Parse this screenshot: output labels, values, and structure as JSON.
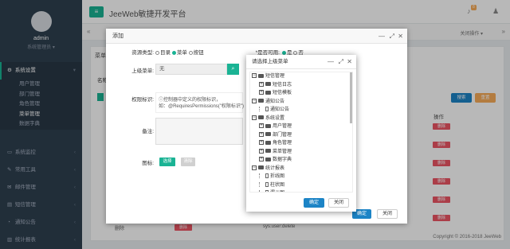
{
  "topbar": {
    "title": "JeeWeb敏捷开发平台",
    "close_ops": "关闭操作 ▾"
  },
  "sidebar": {
    "user": {
      "name": "admin",
      "role": "系统管理员 ▾"
    },
    "sections": [
      {
        "label": "系统设置",
        "icon": "gear-icon"
      },
      {
        "label": "系统监控",
        "icon": "monitor-icon"
      },
      {
        "label": "常用工具",
        "icon": "tool-icon"
      },
      {
        "label": "邮件管理",
        "icon": "mail-icon"
      },
      {
        "label": "短信管理",
        "icon": "sms-icon"
      },
      {
        "label": "通知公告",
        "icon": "bell-icon"
      },
      {
        "label": "统计报表",
        "icon": "chart-icon"
      }
    ],
    "sub": [
      "用户管理",
      "部门管理",
      "角色管理",
      "菜单管理",
      "数据字典"
    ]
  },
  "background": {
    "page_label": "菜单",
    "name_label": "名称",
    "search": "搜索",
    "reset": "重置",
    "col_action": "操作",
    "row_delete": "删除",
    "last_row_name": "删除",
    "last_row_perm": "sys:user:delete",
    "copyright": "Copyright © 2016-2018 JeeWeb"
  },
  "add_dialog": {
    "title": "添加",
    "resource_type_label": "资源类型:",
    "type_options": [
      "目录",
      "菜单",
      "按钮"
    ],
    "show_label": "*是否可用:",
    "show_options": [
      "是",
      "否"
    ],
    "parent_label": "上级菜单:",
    "parent_value": "无",
    "perm_label": "权限标识:",
    "perm_hint1": "控制器中定义的权限标识，",
    "perm_hint2": "如：@RequiresPermissions(\"权限标识\")",
    "remark_label": "备注:",
    "icon_label": "图标:",
    "select_btn": "选择",
    "clear_btn": "清除",
    "ok": "确定",
    "close": "关闭"
  },
  "tree_dialog": {
    "title": "请选择上级菜单",
    "ok": "确定",
    "cancel": "关闭",
    "nodes": [
      {
        "label": "短信管理",
        "level": 0,
        "type": "folder-open"
      },
      {
        "label": "短信日志",
        "level": 1,
        "type": "folder"
      },
      {
        "label": "短信模板",
        "level": 1,
        "type": "folder"
      },
      {
        "label": "通知公告",
        "level": 0,
        "type": "folder-open"
      },
      {
        "label": "通知公告",
        "level": 1,
        "type": "doc"
      },
      {
        "label": "系统设置",
        "level": 0,
        "type": "folder-open"
      },
      {
        "label": "用户管理",
        "level": 1,
        "type": "folder"
      },
      {
        "label": "部门管理",
        "level": 1,
        "type": "folder"
      },
      {
        "label": "角色管理",
        "level": 1,
        "type": "folder"
      },
      {
        "label": "菜单管理",
        "level": 1,
        "type": "folder"
      },
      {
        "label": "数据字典",
        "level": 1,
        "type": "folder"
      },
      {
        "label": "统计报表",
        "level": 0,
        "type": "folder-open"
      },
      {
        "label": "折线图",
        "level": 1,
        "type": "doc"
      },
      {
        "label": "柱状图",
        "level": 1,
        "type": "doc"
      },
      {
        "label": "漏斗图",
        "level": 1,
        "type": "doc"
      }
    ]
  }
}
